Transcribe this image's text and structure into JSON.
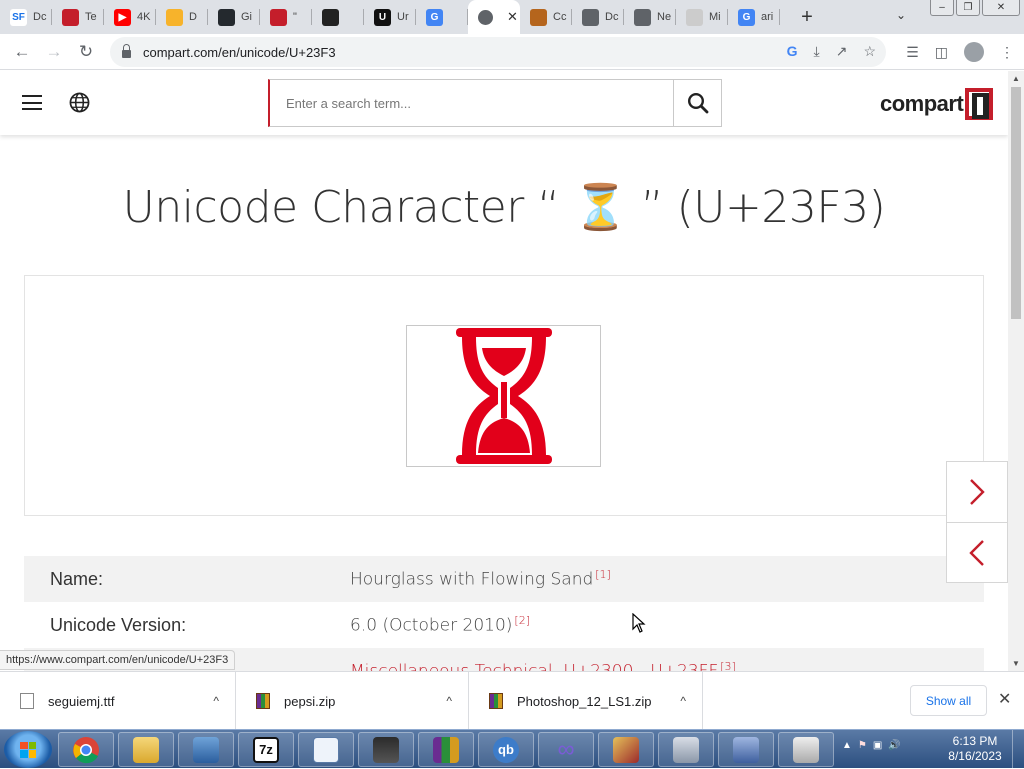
{
  "browser": {
    "tabs": [
      {
        "label": "Dc",
        "fav_text": "SF",
        "fav_color": "#ffffff",
        "fav_fg": "#1a73e8"
      },
      {
        "label": "Te",
        "fav_text": "",
        "fav_color": "#c41e2b"
      },
      {
        "label": "4K",
        "fav_text": "▶",
        "fav_color": "#ff0000"
      },
      {
        "label": "D",
        "fav_text": "",
        "fav_color": "#f7b32b"
      },
      {
        "label": "Gi",
        "fav_text": "",
        "fav_color": "#24292e"
      },
      {
        "label": "\"",
        "fav_text": "",
        "fav_color": "#c41e2b"
      },
      {
        "label": "",
        "fav_text": "",
        "fav_color": "#222222"
      },
      {
        "label": "Ur",
        "fav_text": "U",
        "fav_color": "#111111"
      },
      {
        "label": "",
        "fav_text": "G",
        "fav_color": "#4285f4"
      },
      {
        "label": "",
        "fav_text": "",
        "fav_color": "#5f6368",
        "active": true
      },
      {
        "label": "Cc",
        "fav_text": "",
        "fav_color": "#b5651d"
      },
      {
        "label": "Dc",
        "fav_text": "",
        "fav_color": "#5f6368"
      },
      {
        "label": "Ne",
        "fav_text": "",
        "fav_color": "#5f6368"
      },
      {
        "label": "Mi",
        "fav_text": "",
        "fav_color": "#cccccc"
      },
      {
        "label": "ari",
        "fav_text": "G",
        "fav_color": "#4285f4"
      }
    ],
    "url": "compart.com/en/unicode/U+23F3"
  },
  "site": {
    "search_placeholder": "Enter a search term...",
    "logo_text": "compart",
    "accent": "#c41e2b"
  },
  "page": {
    "title": "Unicode Character “ ⏳ ” (U+23F3)",
    "glyph_color": "#e2001a",
    "rows": [
      {
        "key": "Name:",
        "value": "Hourglass with Flowing Sand",
        "ref": "[1]"
      },
      {
        "key": "Unicode Version:",
        "value": "6.0 (October 2010)",
        "ref": "[2]"
      },
      {
        "key": "",
        "value": "Miscellaneous Technical, U+2300 - U+23FF",
        "ref": "[3]"
      }
    ],
    "status_url": "https://www.compart.com/en/unicode/U+23F3"
  },
  "downloads": {
    "items": [
      {
        "name": "seguiemj.ttf",
        "type": "font"
      },
      {
        "name": "pepsi.zip",
        "type": "zip"
      },
      {
        "name": "Photoshop_12_LS1.zip",
        "type": "zip"
      }
    ],
    "show_all": "Show all"
  },
  "taskbar": {
    "time": "6:13 PM",
    "date": "8/16/2023"
  }
}
